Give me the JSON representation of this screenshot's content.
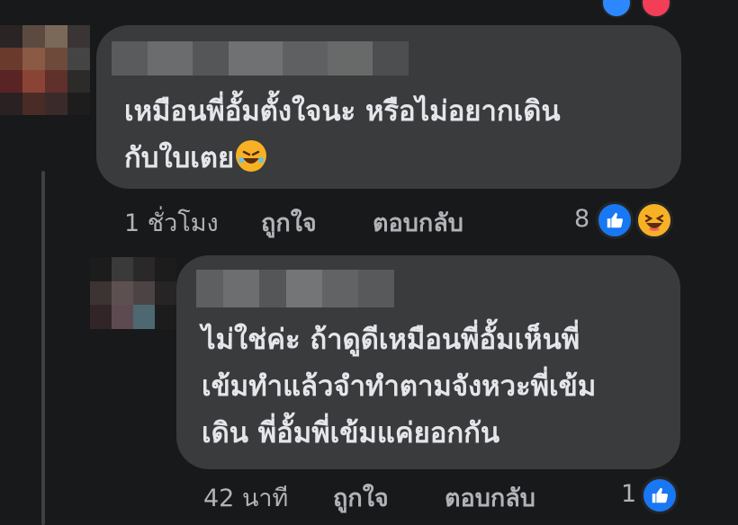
{
  "comments": [
    {
      "text_lines": [
        "เหมือนพี่อั้มตั้งใจนะ หรือไม่อยากเดิน",
        "กับใบเตย"
      ],
      "emoji": "rolling-laughing-emoji",
      "time": "1 ชั่วโมง",
      "like_label": "ถูกใจ",
      "reply_label": "ตอบกลับ",
      "reaction_count": "8",
      "reactions": [
        "like-icon",
        "haha-icon"
      ]
    },
    {
      "text_lines": [
        "ไม่ใช่ค่ะ ถ้าดูดีเหมือนพี่อั้มเห็นพี่",
        "เข้มทำแล้วจำทำตามจังหวะพี่เข้ม",
        "เดิน พี่อั้มพี่เข้มแค่ยอกกัน"
      ],
      "time": "42 นาที",
      "like_label": "ถูกใจ",
      "reply_label": "ตอบกลับ",
      "reaction_count": "1",
      "reactions": [
        "like-icon"
      ]
    }
  ],
  "colors": {
    "background": "#18191a",
    "bubble": "#3a3b3c",
    "text": "#e4e6eb",
    "meta": "#b0b3b8",
    "like_blue": "#1877f2",
    "haha_yellow": "#f7b125"
  }
}
